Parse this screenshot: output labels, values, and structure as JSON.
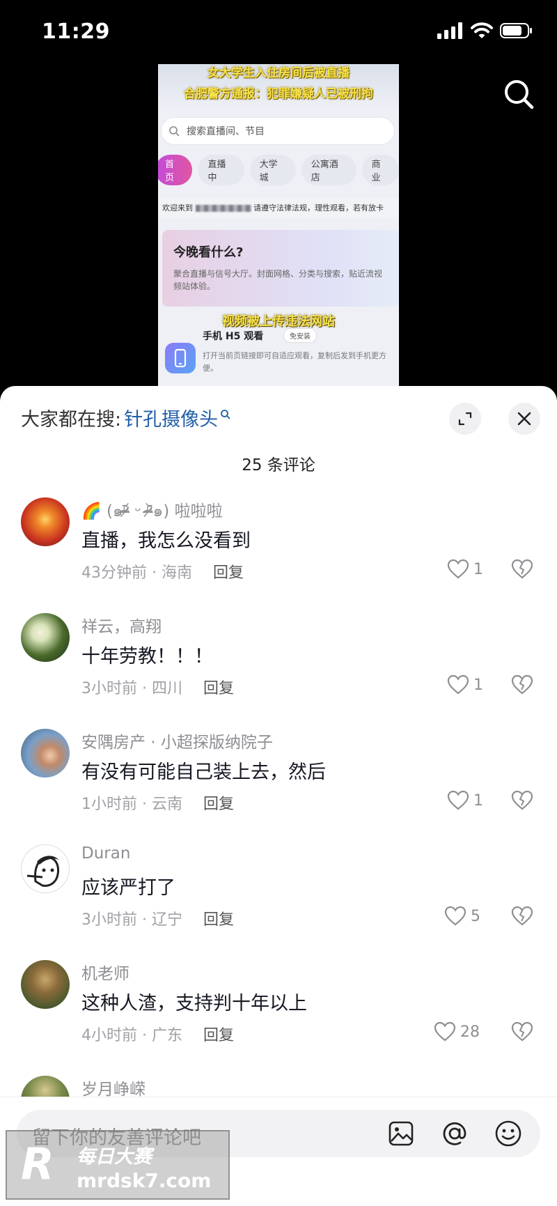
{
  "status": {
    "time": "11:29"
  },
  "video": {
    "banner_line1": "女大学生入住房间后被直播",
    "banner_line2": "合肥警方通报：犯罪嫌疑人已被刑拘",
    "search_placeholder": "搜索直播间、节目",
    "tabs": [
      "首页",
      "直播中",
      "大学城",
      "公寓酒店",
      "商业"
    ],
    "notice_prefix": "欢迎来到",
    "notice_suffix": "请遵守法律法规，理性观看，若有放卡",
    "card_title": "今晚看什么?",
    "card_desc": "聚合直播与信号大厅。封面网格、分类与搜索，贴近流视频站体验。",
    "caption": "视频被上传违法网站",
    "app_title": "手机 H5 观看",
    "app_badge": "免安装",
    "app_desc": "打开当前页链接即可自适应观看，复制后发到手机更方便。"
  },
  "sheet": {
    "hot_label": "大家都在搜:",
    "hot_term": "针孔摄像头",
    "count": "25 条评论",
    "comments": [
      {
        "name": "🌈 (๑ᵒ̴̶̷᷄ ᵕ ᵒ̴̶̷᷅๑) 啦啦啦",
        "text": "直播，我怎么没看到",
        "time": "43分钟前 · 海南",
        "reply": "回复",
        "likes": "1",
        "avatar_color": "#d9462b"
      },
      {
        "name": "祥云，高翔",
        "text": "十年劳教！！！",
        "time": "3小时前 · 四川",
        "reply": "回复",
        "likes": "1",
        "avatar_color": "#3c4a2c"
      },
      {
        "name": "安隅房产 · 小超探版纳院子",
        "text": "有没有可能自己装上去，然后",
        "time": "1小时前 · 云南",
        "reply": "回复",
        "likes": "1",
        "avatar_color": "#6a8bb0"
      },
      {
        "name": "Duran",
        "text": "应该严打了",
        "time": "3小时前 · 辽宁",
        "reply": "回复",
        "likes": "5",
        "avatar_color": "#ffffff"
      },
      {
        "name": "机老师",
        "text": "这种人渣，支持判十年以上",
        "time": "4小时前 · 广东",
        "reply": "回复",
        "likes": "28",
        "avatar_color": "#7a6a4a"
      },
      {
        "name": "岁月峥嵘",
        "text": "",
        "time": "",
        "reply": "",
        "likes": "",
        "avatar_color": "#5a6a3a"
      }
    ],
    "input_placeholder": "留下你的友善评论吧"
  },
  "watermark": {
    "letter": "R",
    "cn": "每日大赛",
    "url": "mrdsk7.com"
  }
}
